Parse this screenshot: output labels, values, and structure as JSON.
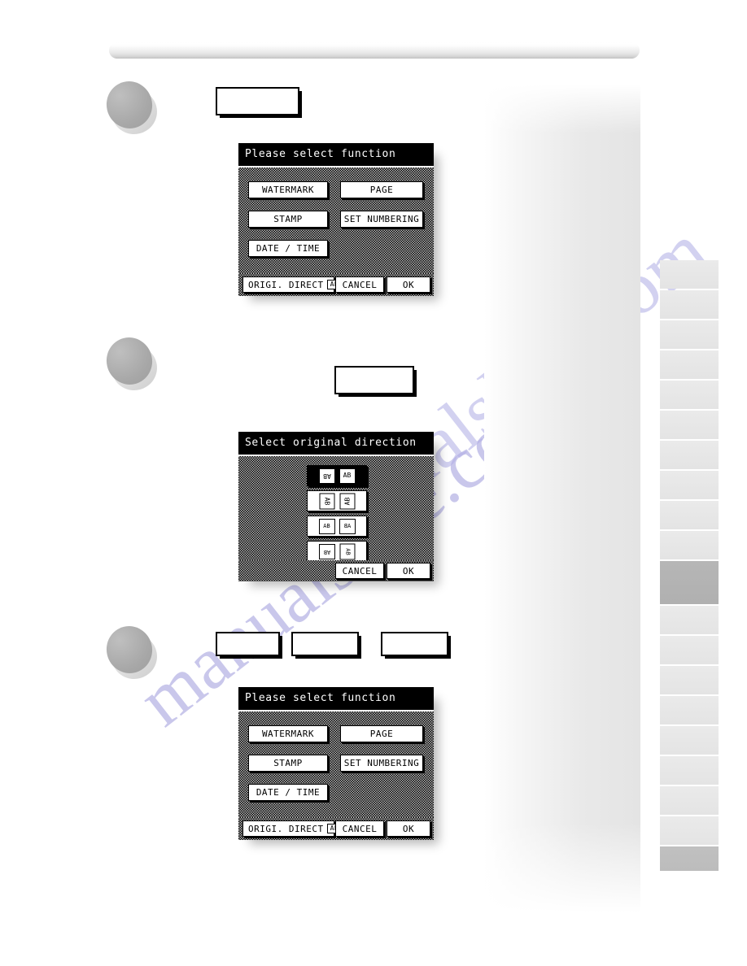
{
  "watermark": {
    "text_a": "manualslive.com",
    "text_b": "manualslive.com",
    "color": "#a9a6e0"
  },
  "colors": {
    "lcd_bg": "#b9b9b9",
    "lcd_title_bg": "#000000",
    "tab_idle": "#e6e6e6",
    "tab_active": "#b3b3b3"
  },
  "steps": [
    {
      "id": "step-1",
      "keys": [
        ""
      ]
    },
    {
      "id": "step-2",
      "keys": [
        ""
      ]
    },
    {
      "id": "step-3",
      "keys": [
        "",
        "",
        ""
      ]
    }
  ],
  "dialog_function": {
    "title": "Please select function",
    "buttons": [
      {
        "label": "WATERMARK"
      },
      {
        "label": "PAGE"
      },
      {
        "label": "STAMP"
      },
      {
        "label": "SET NUMBERING"
      },
      {
        "label": "DATE / TIME"
      }
    ],
    "orig_direct_label": "ORIGI. DIRECT",
    "orig_direct_value": "AB",
    "cancel_label": "CANCEL",
    "ok_label": "OK"
  },
  "dialog_direction": {
    "title": "Select original direction",
    "rows": [
      {
        "left": "AB",
        "right": "AB",
        "selected": true
      },
      {
        "left": "AB",
        "right": "AB",
        "selected": false
      },
      {
        "left": "AB",
        "right": "AB",
        "selected": false
      },
      {
        "left": "AB",
        "right": "AB",
        "selected": false
      }
    ],
    "cancel_label": "CANCEL",
    "ok_label": "OK"
  },
  "dialog_function_2": {
    "title": "Please select function",
    "buttons": [
      {
        "label": "WATERMARK"
      },
      {
        "label": "PAGE"
      },
      {
        "label": "STAMP"
      },
      {
        "label": "SET NUMBERING"
      },
      {
        "label": "DATE / TIME"
      }
    ],
    "orig_direct_label": "ORIGI. DIRECT",
    "orig_direct_value": "AB",
    "cancel_label": "CANCEL",
    "ok_label": "OK"
  },
  "tabs": {
    "count": 19,
    "active_index": 9
  }
}
